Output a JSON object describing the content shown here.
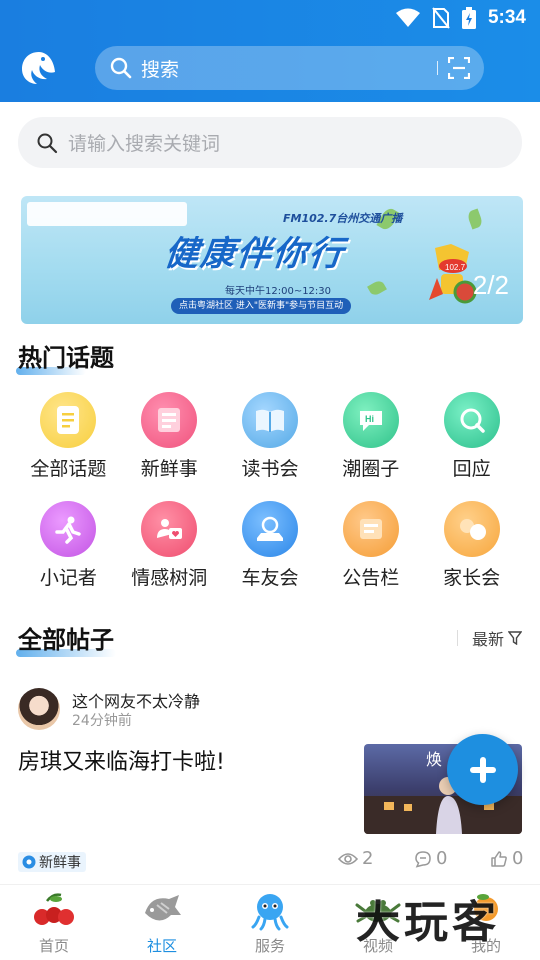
{
  "status_bar": {
    "time": "5:34"
  },
  "header": {
    "search_label": "搜索"
  },
  "search": {
    "placeholder": "请输入搜索关键词"
  },
  "banner": {
    "frequency": "FM102.7台州交通广播",
    "slogan": "健康伴你行",
    "schedule": "每天中午12:00~12:30",
    "notice": "点击粤湖社区 进入\"医新事\"参与节目互动",
    "page_indicator": "2/2"
  },
  "hot_topics": {
    "title": "热门话题",
    "items": [
      {
        "label": "全部话题",
        "icon": "document-icon",
        "color": "#f7cf3f"
      },
      {
        "label": "新鲜事",
        "icon": "news-icon",
        "color": "#f0537d"
      },
      {
        "label": "读书会",
        "icon": "book-icon",
        "color": "#54a9e6"
      },
      {
        "label": "潮圈子",
        "icon": "chat-hi-icon",
        "color": "#2fc28a"
      },
      {
        "label": "回应",
        "icon": "reply-icon",
        "color": "#2cbf8c"
      },
      {
        "label": "小记者",
        "icon": "runner-icon",
        "color": "#c354e4"
      },
      {
        "label": "情感树洞",
        "icon": "heart-chat-icon",
        "color": "#ef4d6f"
      },
      {
        "label": "车友会",
        "icon": "car-icon",
        "color": "#2a86e8"
      },
      {
        "label": "公告栏",
        "icon": "announcement-icon",
        "color": "#f59d35"
      },
      {
        "label": "家长会",
        "icon": "family-icon",
        "color": "#f7a63c"
      }
    ]
  },
  "posts_section": {
    "title": "全部帖子",
    "sort_label": "最新"
  },
  "post": {
    "author": "这个网友不太冷静",
    "time": "24分钟前",
    "title": "房琪又来临海打卡啦!",
    "thumb_text": "焕",
    "tag": "新鲜事",
    "views": "2",
    "comments": "0",
    "likes": "0"
  },
  "bottom_nav": [
    {
      "label": "首页",
      "icon": "cherries-icon"
    },
    {
      "label": "社区",
      "icon": "fish-icon",
      "active": true
    },
    {
      "label": "服务",
      "icon": "octopus-icon"
    },
    {
      "label": "视频",
      "icon": "crab-icon"
    },
    {
      "label": "我的",
      "icon": "profile-icon"
    }
  ],
  "watermark": "大玩客",
  "colors": {
    "primary": "#1e8fe0",
    "header": "#1a7ee0"
  }
}
